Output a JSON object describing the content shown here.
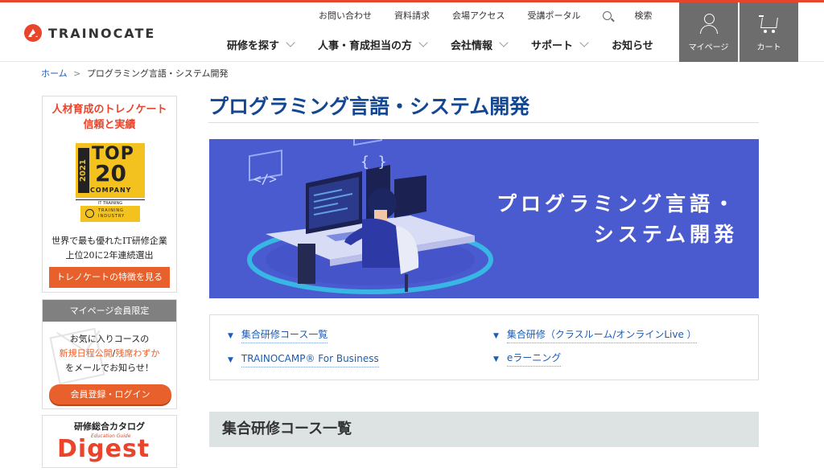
{
  "header": {
    "logo_text": "TRAINOCATE",
    "util_nav": [
      "お問い合わせ",
      "資料請求",
      "会場アクセス",
      "受講ポータル"
    ],
    "search_label": "検索",
    "main_nav": [
      "研修を探す",
      "人事・育成担当の方",
      "会社情報",
      "サポート",
      "お知らせ"
    ],
    "mypage_label": "マイページ",
    "cart_label": "カート"
  },
  "breadcrumb": {
    "home": "ホーム",
    "separator": ">",
    "current": "プログラミング言語・システム開発"
  },
  "sidebar": {
    "box1": {
      "title_line1": "人材育成のトレノケート",
      "title_line2": "信頼と実績",
      "badge_year": "2021",
      "badge_top": "TOP",
      "badge_num": "20",
      "badge_company": "COMPANY",
      "badge_it": "IT TRAINING",
      "badge_ti1": "TRAINING",
      "badge_ti2": "INDUSTRY",
      "text_line1": "世界で最も優れたIT研修企業",
      "text_line2": "上位20に2年連続選出",
      "button": "トレノケートの特徴を見る"
    },
    "box2": {
      "header": "マイページ会員限定",
      "line1": "お気に入りコースの",
      "line2_a": "新規日程公開",
      "line2_sep": "/",
      "line2_b": "残席わずか",
      "line3": "をメールでお知らせ！",
      "button": "会員登録・ログイン"
    },
    "box3": {
      "title": "研修総合カタログ",
      "sub": "Education Guide",
      "big": "Digest"
    }
  },
  "main": {
    "page_title": "プログラミング言語・システム開発",
    "banner_line1": "プログラミング言語・",
    "banner_line2": "システム開発",
    "banner_code_glyph": "</>",
    "banner_brace_glyph": "{ }",
    "links": [
      "集合研修コース一覧",
      "TRAINOCAMP® For Business",
      "集合研修（クラスルーム/オンラインLive ）",
      "eラーニング"
    ],
    "link_marker": "▼",
    "section_heading": "集合研修コース一覧"
  },
  "colors": {
    "brand_red": "#e8452c",
    "title_blue": "#134791",
    "link_blue": "#1d5cb4",
    "banner_bg": "#4a5bd0",
    "header_button_gray": "#6d6d6d",
    "section_head_bg": "#dde3e3"
  }
}
